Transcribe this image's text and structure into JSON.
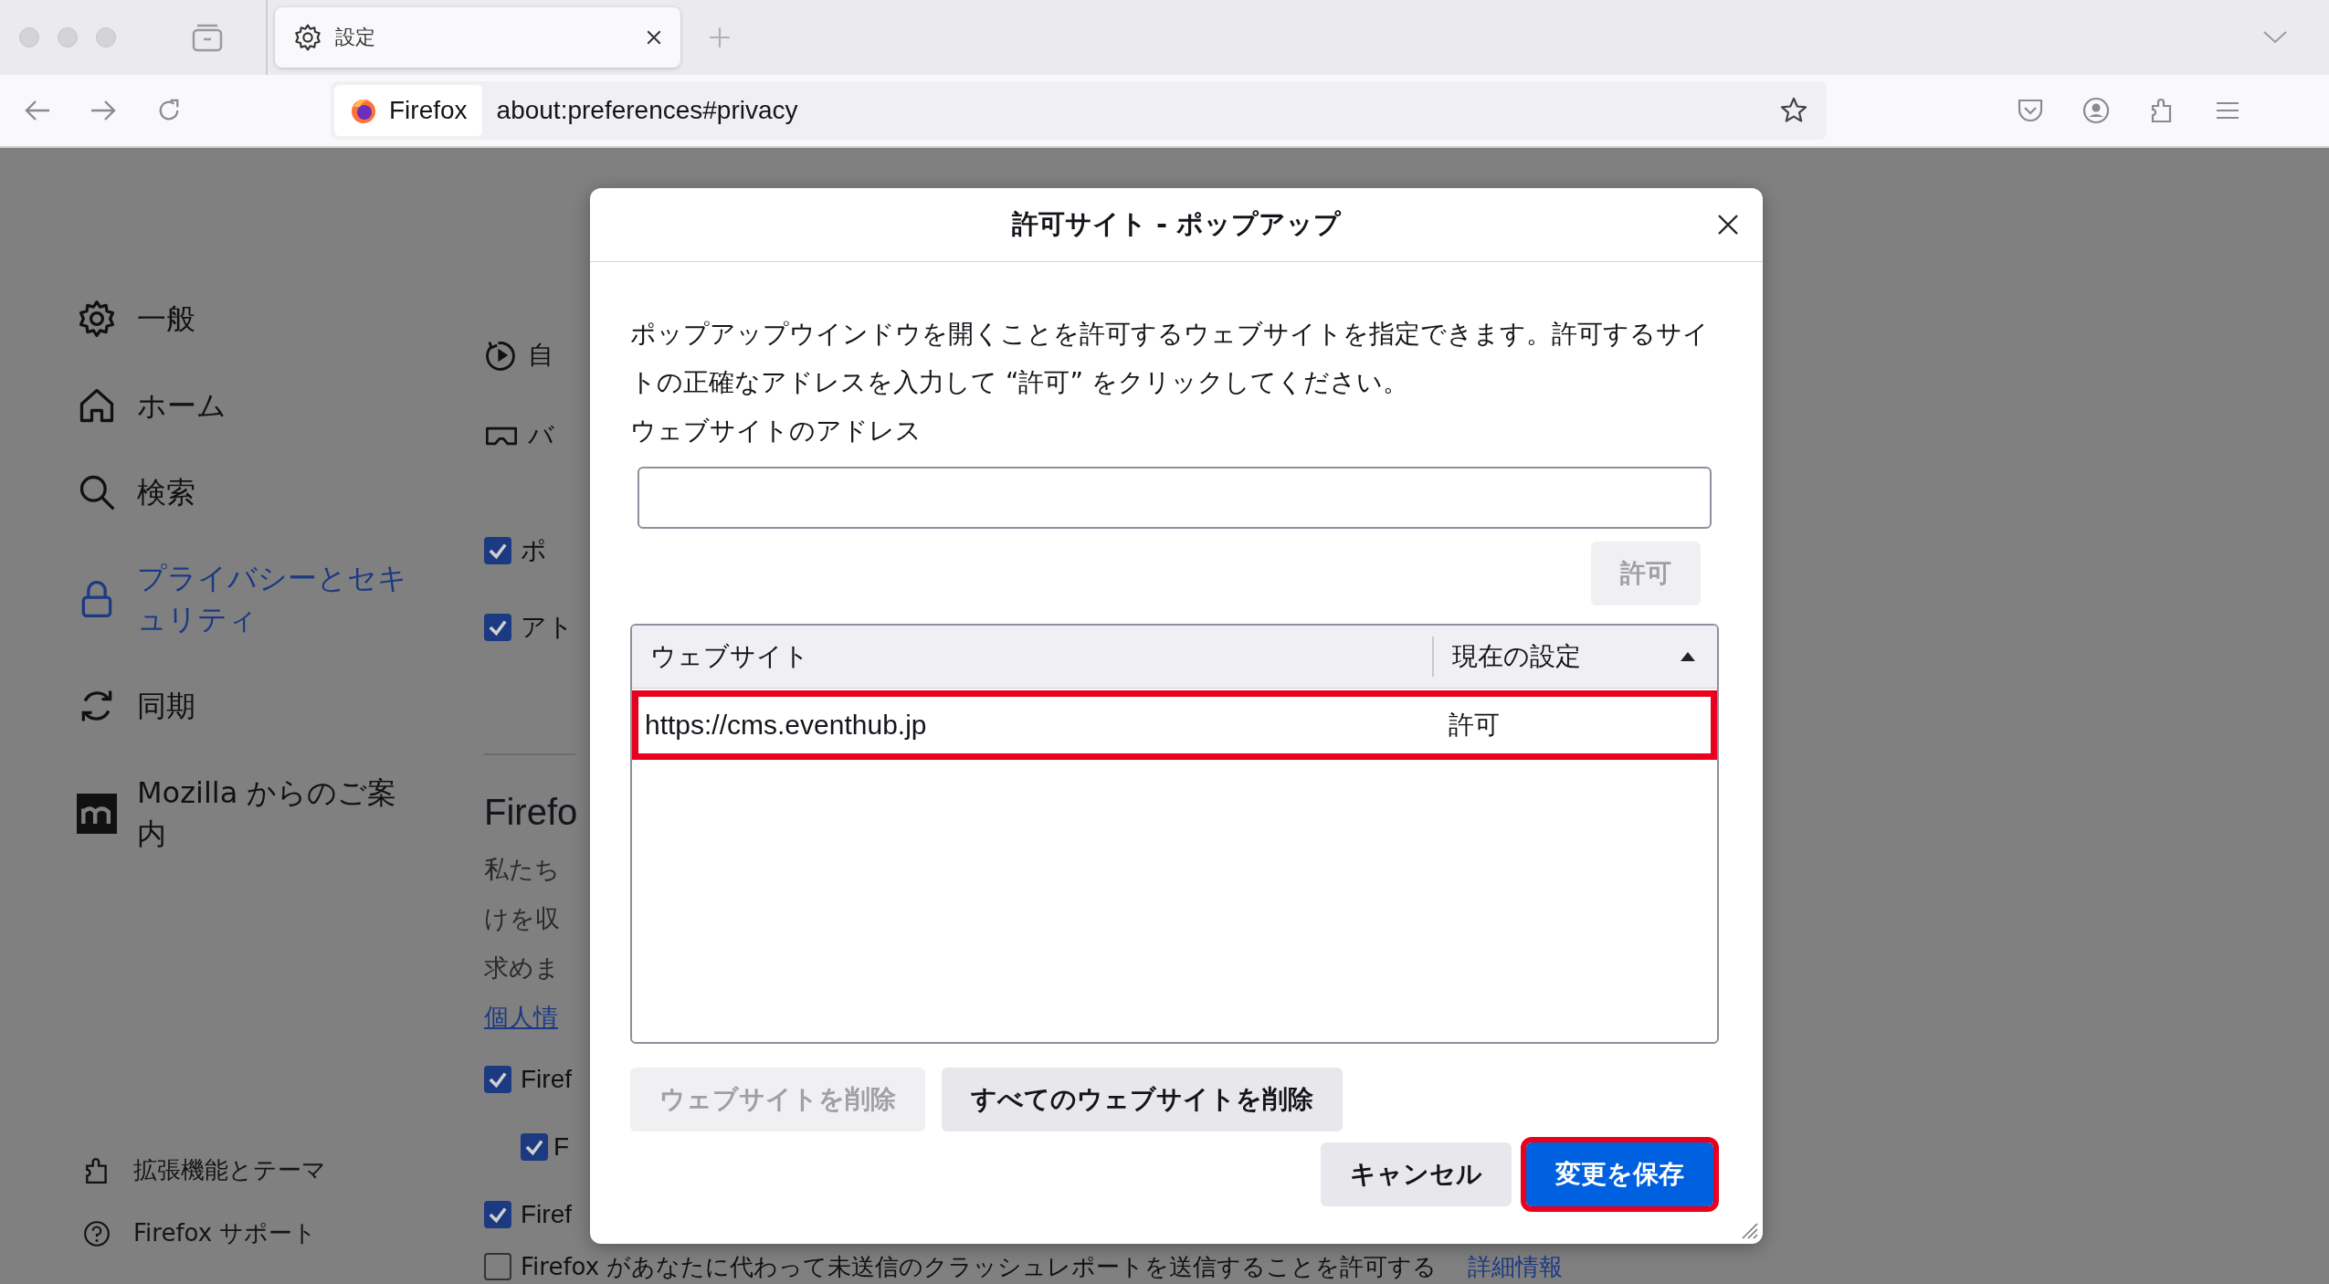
{
  "browser": {
    "tabs": [
      {
        "label": "設定",
        "selected": true
      }
    ],
    "identity": "Firefox",
    "url": "about:preferences#privacy"
  },
  "sidebar": {
    "items": [
      {
        "label": "一般",
        "selected": false
      },
      {
        "label": "ホーム",
        "selected": false
      },
      {
        "label": "検索",
        "selected": false
      },
      {
        "label": "プライバシーとセキュリティ",
        "selected": true
      },
      {
        "label": "同期",
        "selected": false
      },
      {
        "label": "Mozilla からのご案内",
        "selected": false
      }
    ],
    "footer": [
      {
        "label": "拡張機能とテーマ"
      },
      {
        "label": "Firefox サポート"
      }
    ]
  },
  "content": {
    "items": [
      {
        "kind": "icon-row",
        "text": "自"
      },
      {
        "kind": "icon-row",
        "text": "バ"
      },
      {
        "kind": "checkbox",
        "text": "ポ",
        "checked": true
      },
      {
        "kind": "checkbox",
        "text": "アト",
        "checked": true
      },
      {
        "kind": "heading",
        "text": "Firefo"
      },
      {
        "kind": "text",
        "text": "私たち"
      },
      {
        "kind": "text",
        "text": "けを収"
      },
      {
        "kind": "text",
        "text": "求めま"
      },
      {
        "kind": "link",
        "text": "個人情"
      },
      {
        "kind": "checkbox",
        "text": "Firef",
        "checked": true,
        "children": [
          {
            "text": "F",
            "checked": true
          }
        ]
      },
      {
        "kind": "checkbox",
        "text": "Firef",
        "checked": true
      }
    ],
    "last_option": {
      "text": "Firefox があなたに代わって未送信のクラッシュレポートを送信することを許可する",
      "checked": false,
      "link": "詳細情報"
    }
  },
  "dialog": {
    "title": "許可サイト - ポップアップ",
    "description": "ポップアップウインドウを開くことを許可するウェブサイトを指定できます。許可するサイトの正確なアドレスを入力して “許可” をクリックしてください。",
    "address_label": "ウェブサイトのアドレス",
    "allow_button": {
      "label": "許可",
      "disabled": true
    },
    "table": {
      "columns": [
        {
          "label": "ウェブサイト",
          "sorted": false
        },
        {
          "label": "現在の設定",
          "sorted": true
        }
      ],
      "rows": [
        {
          "website": "https://cms.eventhub.jp",
          "status": "許可",
          "highlighted": true
        }
      ]
    },
    "remove_button": {
      "label": "ウェブサイトを削除",
      "disabled": true
    },
    "remove_all_button": {
      "label": "すべてのウェブサイトを削除",
      "disabled": false
    },
    "cancel_button": {
      "label": "キャンセル"
    },
    "save_button": {
      "label": "変更を保存",
      "highlighted": true
    }
  }
}
